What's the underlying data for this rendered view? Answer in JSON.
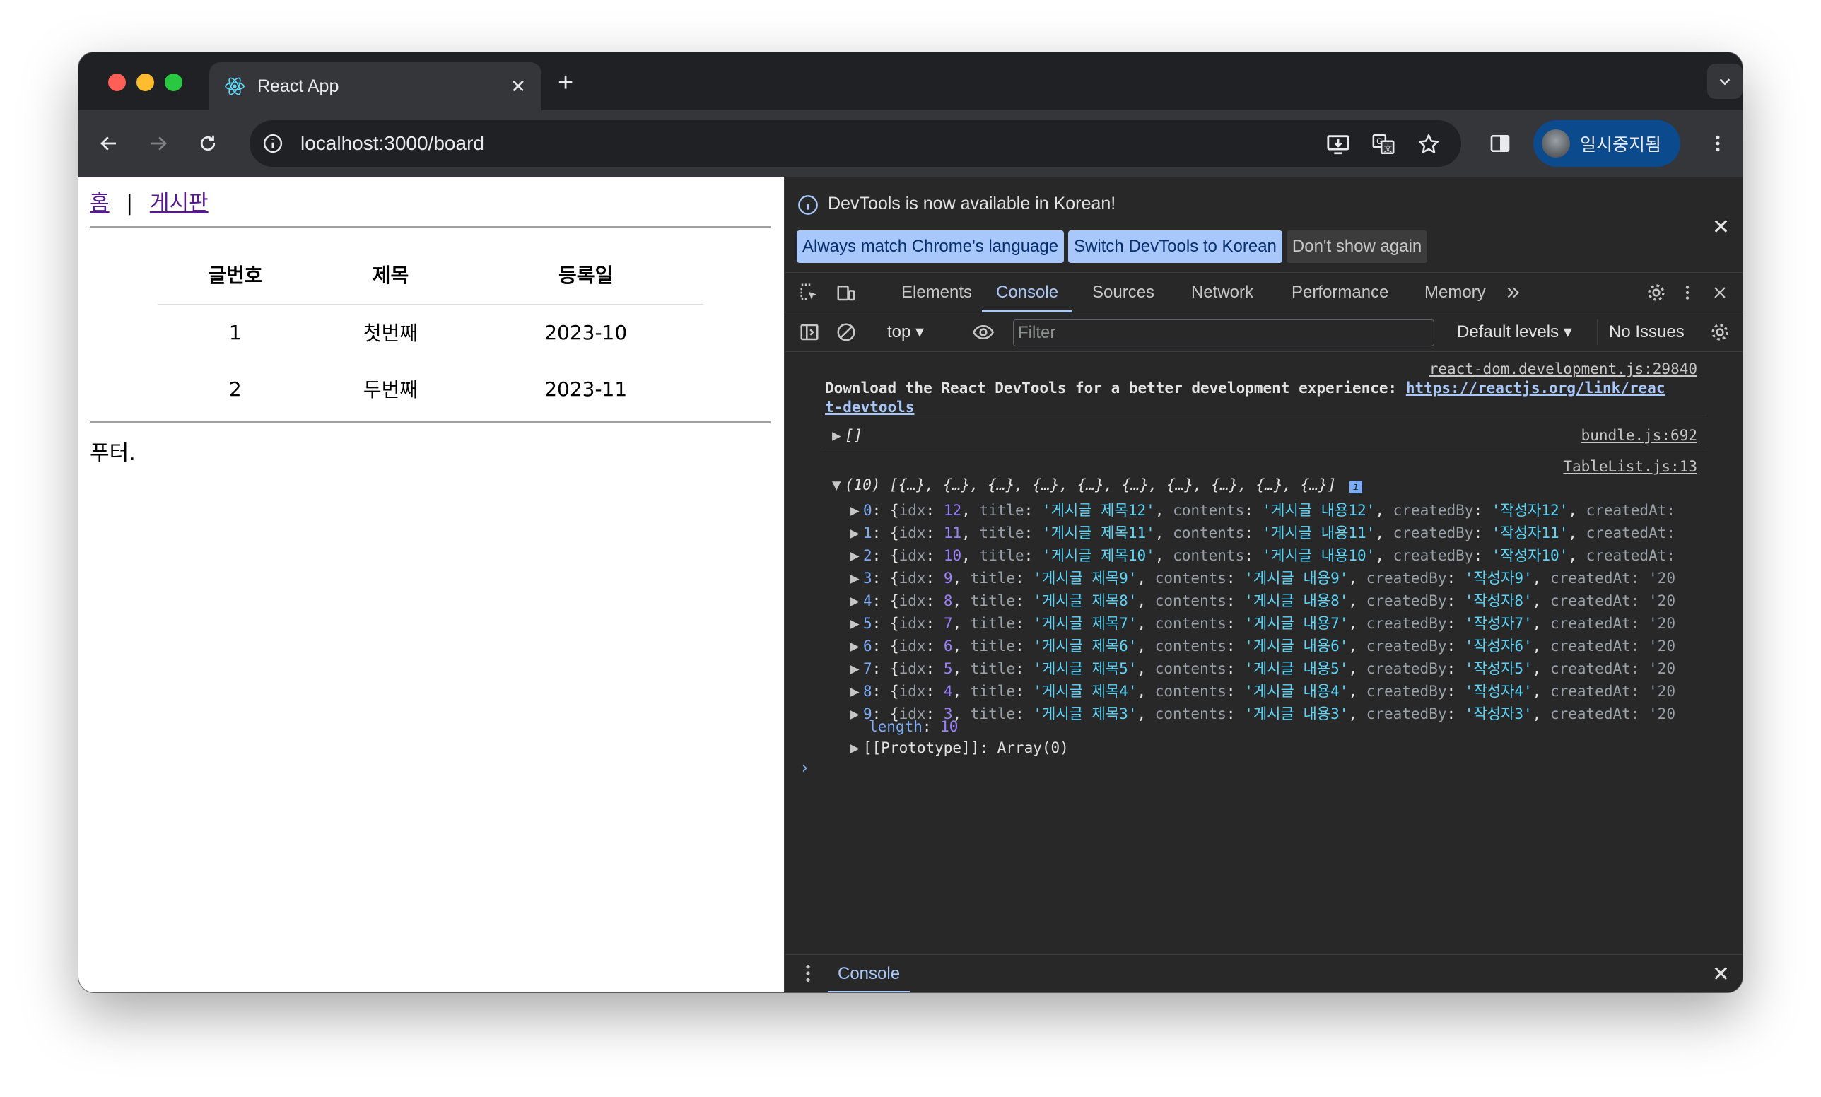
{
  "browser": {
    "tab": {
      "title": "React App"
    },
    "address_bar": {
      "url": "localhost:3000/board"
    },
    "profile": {
      "label": "일시중지됨"
    }
  },
  "page": {
    "nav": {
      "home": "홈",
      "separator": "|",
      "board": "게시판"
    },
    "table": {
      "headers": [
        "글번호",
        "제목",
        "등록일"
      ],
      "rows": [
        [
          "1",
          "첫번째",
          "2023-10"
        ],
        [
          "2",
          "두번째",
          "2023-11"
        ]
      ]
    },
    "footer": "푸터."
  },
  "devtools": {
    "infobar": {
      "message": "DevTools is now available in Korean!",
      "buttons": [
        "Always match Chrome's language",
        "Switch DevTools to Korean",
        "Don't show again"
      ]
    },
    "tabs": [
      "Elements",
      "Console",
      "Sources",
      "Network",
      "Performance",
      "Memory"
    ],
    "active_tab": "Console",
    "toolbar": {
      "context": "top",
      "filter_placeholder": "Filter",
      "levels": "Default levels",
      "issues": "No Issues"
    },
    "console": {
      "msg1_source": "react-dom.development.js:29840",
      "msg1_text": "Download the React DevTools for a better development experience: ",
      "msg1_link_a": "https://reactjs.org/link/reac",
      "msg1_link_b": "t-devtools",
      "msg2_text": "[]",
      "msg2_source": "bundle.js:692",
      "msg3_source": "TableList.js:13",
      "msg3_summary": "(10) [{…}, {…}, {…}, {…}, {…}, {…}, {…}, {…}, {…}, {…}]",
      "items": [
        {
          "i": "0",
          "idx": "12",
          "title": "'게시글 제목12'",
          "contents": "'게시글 내용12'",
          "createdBy": "'작성자12'",
          "tail": "createdAt:"
        },
        {
          "i": "1",
          "idx": "11",
          "title": "'게시글 제목11'",
          "contents": "'게시글 내용11'",
          "createdBy": "'작성자11'",
          "tail": "createdAt:"
        },
        {
          "i": "2",
          "idx": "10",
          "title": "'게시글 제목10'",
          "contents": "'게시글 내용10'",
          "createdBy": "'작성자10'",
          "tail": "createdAt:"
        },
        {
          "i": "3",
          "idx": "9",
          "title": "'게시글 제목9'",
          "contents": "'게시글 내용9'",
          "createdBy": "'작성자9'",
          "tail": "createdAt: '20"
        },
        {
          "i": "4",
          "idx": "8",
          "title": "'게시글 제목8'",
          "contents": "'게시글 내용8'",
          "createdBy": "'작성자8'",
          "tail": "createdAt: '20"
        },
        {
          "i": "5",
          "idx": "7",
          "title": "'게시글 제목7'",
          "contents": "'게시글 내용7'",
          "createdBy": "'작성자7'",
          "tail": "createdAt: '20"
        },
        {
          "i": "6",
          "idx": "6",
          "title": "'게시글 제목6'",
          "contents": "'게시글 내용6'",
          "createdBy": "'작성자6'",
          "tail": "createdAt: '20"
        },
        {
          "i": "7",
          "idx": "5",
          "title": "'게시글 제목5'",
          "contents": "'게시글 내용5'",
          "createdBy": "'작성자5'",
          "tail": "createdAt: '20"
        },
        {
          "i": "8",
          "idx": "4",
          "title": "'게시글 제목4'",
          "contents": "'게시글 내용4'",
          "createdBy": "'작성자4'",
          "tail": "createdAt: '20"
        },
        {
          "i": "9",
          "idx": "3",
          "title": "'게시글 제목3'",
          "contents": "'게시글 내용3'",
          "createdBy": "'작성자3'",
          "tail": "createdAt: '20"
        }
      ],
      "length_label": "length",
      "length_value": "10",
      "prototype": "[[Prototype]]: Array(0)"
    },
    "drawer_tab": "Console"
  },
  "icons": [
    "react-icon",
    "back-arrow-icon",
    "forward-arrow-icon",
    "reload-icon",
    "info-icon",
    "install-icon",
    "translate-icon",
    "star-icon",
    "side-panel-icon",
    "more-vert-icon",
    "inspect-icon",
    "device-toggle-icon",
    "settings-gear-icon",
    "close-icon",
    "clear-console-icon",
    "eye-icon",
    "sidebar-toggle-icon"
  ]
}
